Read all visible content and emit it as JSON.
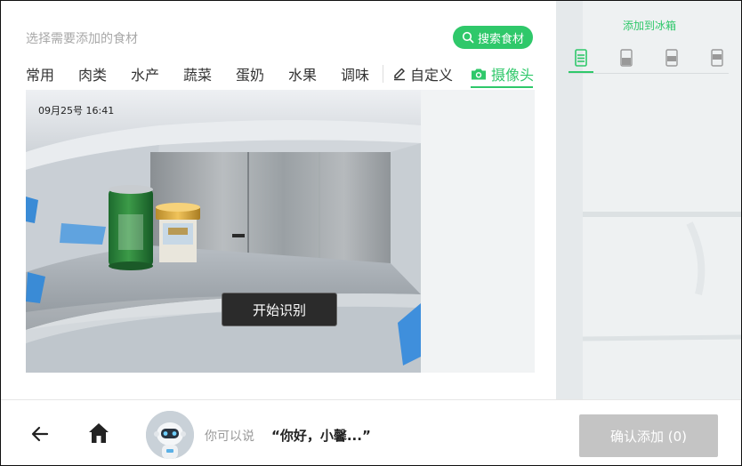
{
  "header": {
    "hint": "选择需要添加的食材",
    "search_label": "搜索食材"
  },
  "tabs": {
    "items": [
      {
        "label": "常用"
      },
      {
        "label": "肉类"
      },
      {
        "label": "水产"
      },
      {
        "label": "蔬菜"
      },
      {
        "label": "蛋奶"
      },
      {
        "label": "水果"
      },
      {
        "label": "调味"
      }
    ],
    "custom_label": "自定义",
    "camera_label": "摄像头"
  },
  "camera": {
    "timestamp": "09月25号 16:41",
    "recognize_label": "开始识别"
  },
  "fridge": {
    "title": "添加到冰箱",
    "selected_shelf": 1
  },
  "bottom": {
    "say_hint": "你可以说",
    "say_quote": "“你好，小馨...”",
    "confirm_label": "确认添加 (0)"
  },
  "colors": {
    "accent": "#2fc86a",
    "disabled": "#c4c4c4"
  }
}
